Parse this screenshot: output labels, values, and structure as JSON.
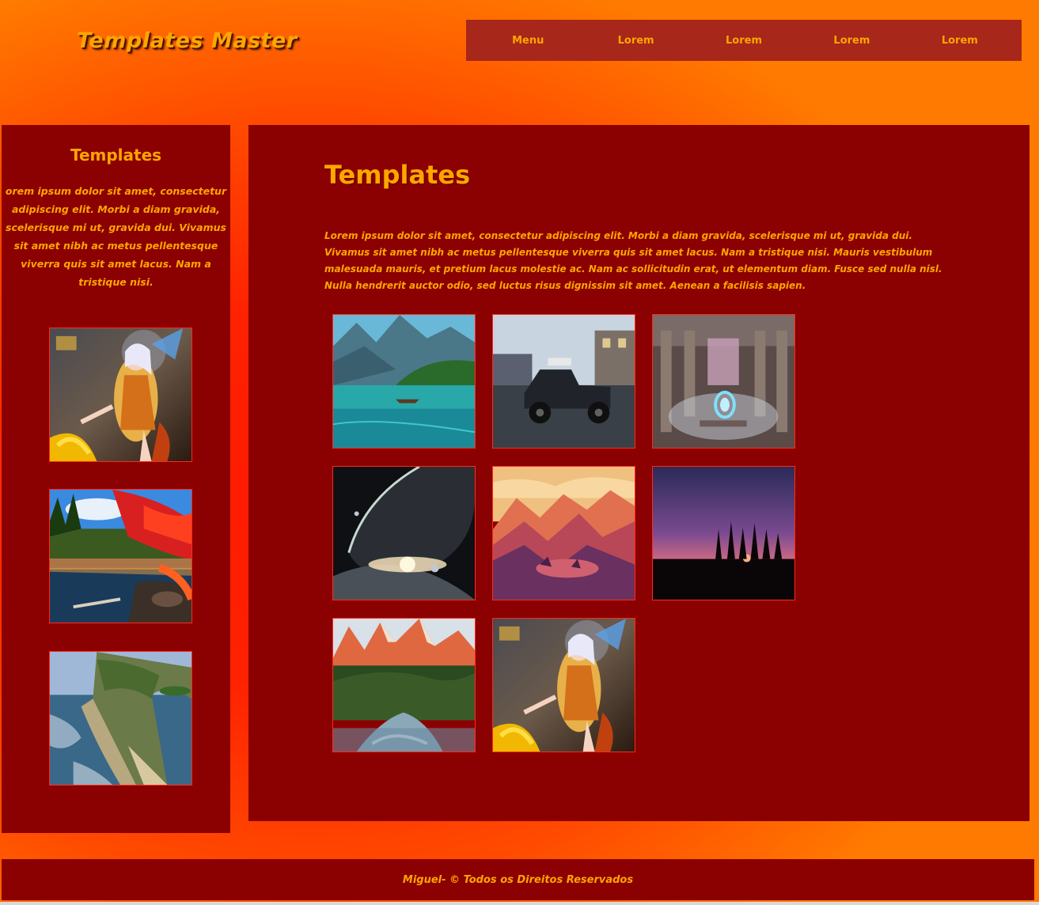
{
  "site": {
    "title": "Templates Master"
  },
  "nav": {
    "items": [
      {
        "label": "Menu"
      },
      {
        "label": "Lorem"
      },
      {
        "label": "Lorem"
      },
      {
        "label": "Lorem"
      },
      {
        "label": "Lorem"
      }
    ]
  },
  "sidebar": {
    "title": "Templates",
    "lines": [
      "orem ipsum dolor sit amet, consectetur",
      "adipiscing elit. Morbi a diam gravida,",
      "scelerisque mi ut, gravida dui. Vivamus",
      "sit amet nibh ac metus pellentesque",
      "viverra quis sit amet lacus. Nam a",
      "tristique nisi."
    ],
    "images": [
      {
        "icon": "fantasy-warrior-image"
      },
      {
        "icon": "autumn-lake-image"
      },
      {
        "icon": "coastal-cliff-image"
      }
    ]
  },
  "main": {
    "title": "Templates",
    "text": "Lorem ipsum dolor sit amet, consectetur adipiscing elit. Morbi a diam gravida, scelerisque mi ut, gravida dui. Vivamus sit amet nibh ac metus pellentesque viverra quis sit amet lacus. Nam a tristique nisi. Mauris vestibulum malesuada mauris, et pretium lacus molestie ac. Nam ac sollicitudin erat, ut elementum diam. Fusce sed nulla nisl. Nulla hendrerit auctor odio, sed luctus risus dignissim sit amet. Aenean a facilisis sapien.",
    "images": [
      {
        "icon": "mountain-lake-image"
      },
      {
        "icon": "truck-image"
      },
      {
        "icon": "temple-portal-image"
      },
      {
        "icon": "planet-space-image"
      },
      {
        "icon": "sunset-valley-illustration-image"
      },
      {
        "icon": "tree-sunset-image"
      },
      {
        "icon": "mountain-river-image"
      },
      {
        "icon": "fantasy-warrior-image"
      }
    ]
  },
  "footer": {
    "text": "Miguel- © Todos os Direitos Reservados"
  },
  "colors": {
    "accent": "#ffa500",
    "panel": "#8b0000",
    "nav_bg": "#a7271a",
    "border": "#ff2a1a"
  }
}
